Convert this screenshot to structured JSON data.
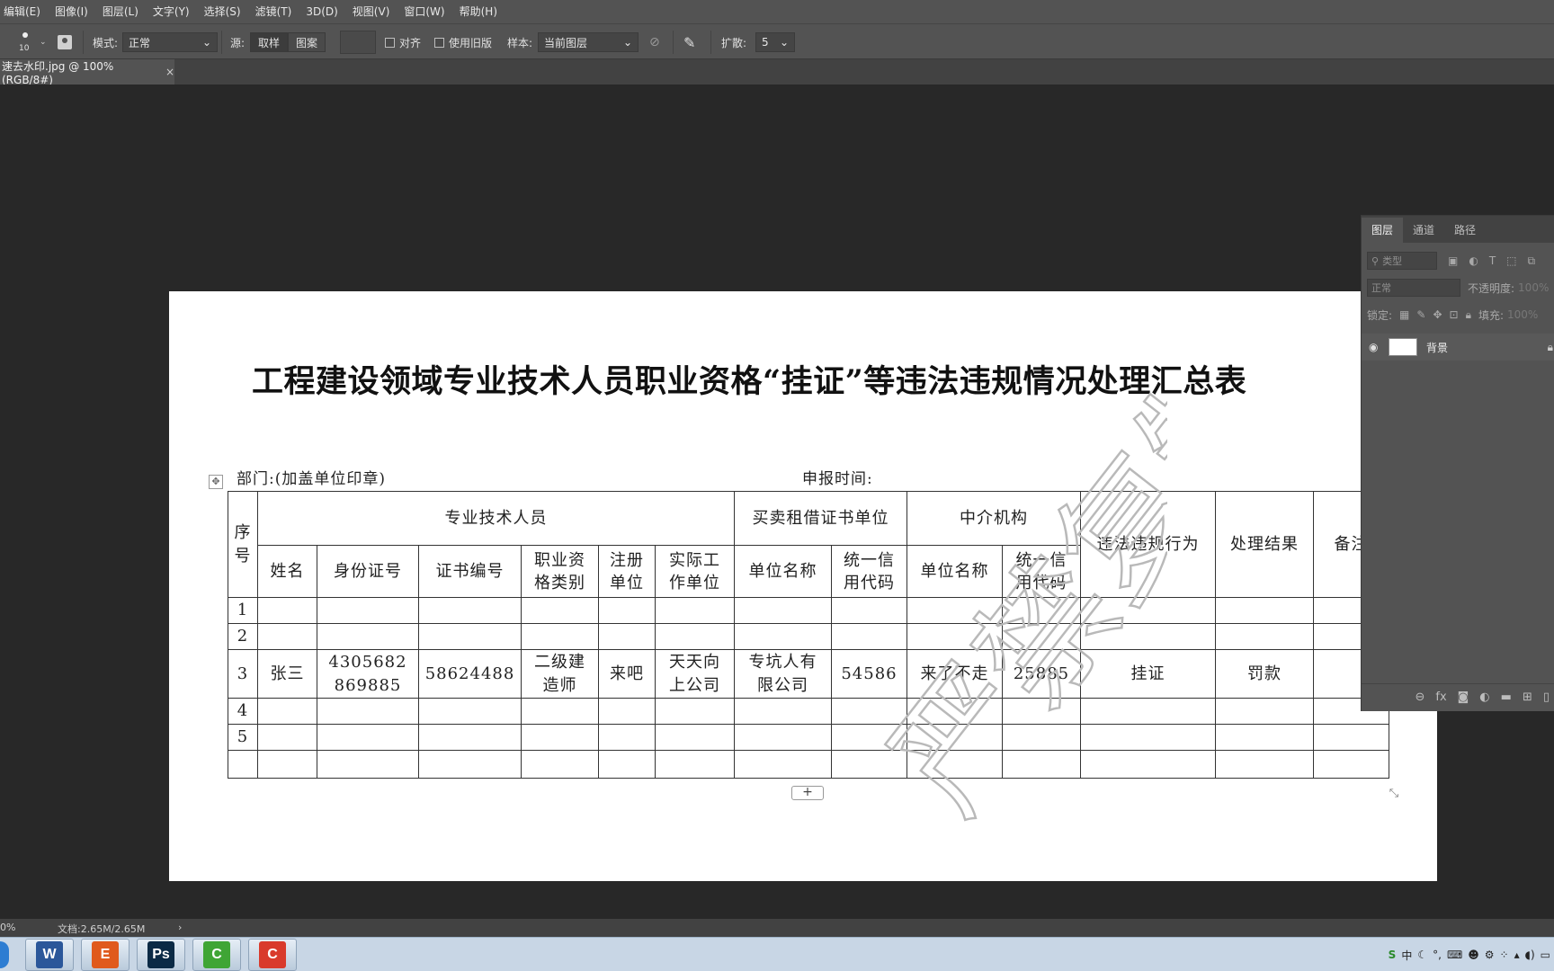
{
  "menu": [
    "编辑(E)",
    "图像(I)",
    "图层(L)",
    "文字(Y)",
    "选择(S)",
    "滤镜(T)",
    "3D(D)",
    "视图(V)",
    "窗口(W)",
    "帮助(H)"
  ],
  "options": {
    "brush_size": "10",
    "mode_label": "模式:",
    "mode_value": "正常",
    "source_label": "源:",
    "sampled_btn": "取样",
    "pattern_btn": "图案",
    "aligned_label": "对齐",
    "legacy_label": "使用旧版",
    "sample_label": "样本:",
    "sample_value": "当前图层",
    "diffusion_label": "扩散:",
    "diffusion_value": "5"
  },
  "document_tab": {
    "title": "速去水印.jpg @ 100%(RGB/8#)",
    "close": "×"
  },
  "document": {
    "title": "工程建设领域专业技术人员职业资格“挂证”等违法违规情况处理汇总表",
    "dept_label": "部门:(加盖单位印章)",
    "date_label": "申报时间:",
    "watermark_text": "严禁复制",
    "table": {
      "h_no": "序号",
      "h_personnel": "专业技术人员",
      "h_trading_unit": "买卖租借证书单位",
      "h_agency": "中介机构",
      "h_violation": "违法违规行为",
      "h_result": "处理结果",
      "h_remark": "备注",
      "sub": [
        "姓名",
        "身份证号",
        "证书编号",
        "职业资格类别",
        "注册单位",
        "实际工作单位",
        "单位名称",
        "统一信用代码",
        "单位名称",
        "统一信用代码"
      ],
      "rows": [
        {
          "no": "1",
          "cells": [
            "",
            "",
            "",
            "",
            "",
            "",
            "",
            "",
            "",
            "",
            "",
            "",
            ""
          ]
        },
        {
          "no": "2",
          "cells": [
            "",
            "",
            "",
            "",
            "",
            "",
            "",
            "",
            "",
            "",
            "",
            "",
            ""
          ]
        },
        {
          "no": "3",
          "cells": [
            "张三",
            "4305682869885",
            "58624488",
            "二级建造师",
            "来吧",
            "天天向上公司",
            "专坑人有限公司",
            "54586",
            "来了不走",
            "25885",
            "挂证",
            "罚款",
            ""
          ]
        },
        {
          "no": "4",
          "cells": [
            "",
            "",
            "",
            "",
            "",
            "",
            "",
            "",
            "",
            "",
            "",
            "",
            ""
          ]
        },
        {
          "no": "5",
          "cells": [
            "",
            "",
            "",
            "",
            "",
            "",
            "",
            "",
            "",
            "",
            "",
            "",
            ""
          ]
        },
        {
          "no": "",
          "cells": [
            "",
            "",
            "",
            "",
            "",
            "",
            "",
            "",
            "",
            "",
            "",
            "",
            ""
          ]
        }
      ]
    }
  },
  "layers_panel": {
    "tabs": [
      "图层",
      "通道",
      "路径"
    ],
    "filter_placeholder": "类型",
    "blend_mode": "正常",
    "opacity_label": "不透明度:",
    "opacity_value": "100%",
    "lock_label": "锁定:",
    "fill_label": "填充:",
    "fill_value": "100%",
    "layers": [
      {
        "name": "背景"
      }
    ]
  },
  "status": {
    "zoom": "0%",
    "doc_info": "文档:2.65M/2.65M"
  },
  "taskbar": {
    "apps": [
      {
        "icon": "word-icon",
        "label": "W",
        "color": "#2b579a"
      },
      {
        "icon": "pdf-icon",
        "label": "E",
        "color": "#e05a1c"
      },
      {
        "icon": "photoshop-icon",
        "label": "Ps",
        "color": "#0b2a45"
      },
      {
        "icon": "camtasia-green-icon",
        "label": "C",
        "color": "#3fa535"
      },
      {
        "icon": "camtasia-red-icon",
        "label": "C",
        "color": "#d93a2b"
      }
    ],
    "tray_ime": "中"
  }
}
